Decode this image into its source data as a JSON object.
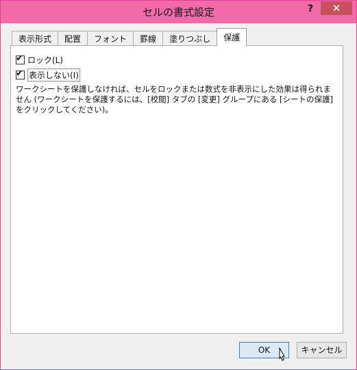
{
  "window": {
    "title": "セルの書式設定",
    "help": "?",
    "close": "✕"
  },
  "tabs": [
    {
      "label": "表示形式"
    },
    {
      "label": "配置"
    },
    {
      "label": "フォント"
    },
    {
      "label": "罫線"
    },
    {
      "label": "塗りつぶし"
    },
    {
      "label": "保護"
    }
  ],
  "protection": {
    "lock_label": "ロック(L)",
    "lock_checked": true,
    "hidden_label": "表示しない(I)",
    "hidden_checked": true,
    "description": "ワークシートを保護しなければ、セルをロックまたは数式を非表示にした効果は得られません (ワークシートを保護するには、[校閲] タブの [変更] グループにある [シートの保護] をクリックしてください)。"
  },
  "buttons": {
    "ok": "OK",
    "cancel": "キャンセル"
  }
}
